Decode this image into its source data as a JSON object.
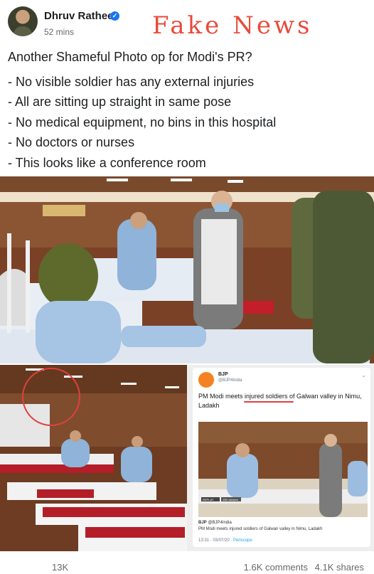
{
  "post": {
    "author": "Dhruv Rathee",
    "time": "52 mins",
    "stamp": "Fake News",
    "lead": "Another Shameful Photo op for Modi's PR?",
    "points": [
      "- No visible soldier has any external injuries",
      "- All are sitting up straight in same pose",
      "- No medical equipment, no bins in this hospital",
      "- No doctors or nurses",
      "- This looks like a conference room"
    ]
  },
  "tweet": {
    "name": "BJP",
    "handle": "@BJP4India",
    "text": "PM Modi meets injured soldiers of Galwan valley in Nimu, Ladakh",
    "quote_name": "BJP",
    "quote_handle": "@BJP4India",
    "quote_text": "PM Modi meets injured soldiers of Galwan valley in Nimu, Ladakh",
    "time": "13:31 · 03/07/20 ·",
    "source": "Periscope",
    "viewers": "15K viewers",
    "replay": "REPLAY"
  },
  "footer": {
    "likes": "13K",
    "comments": "1.6K comments",
    "shares": "4.1K shares"
  },
  "colors": {
    "stamp": "#e84a3a",
    "verified": "#1877f2",
    "circle": "#e04040"
  }
}
